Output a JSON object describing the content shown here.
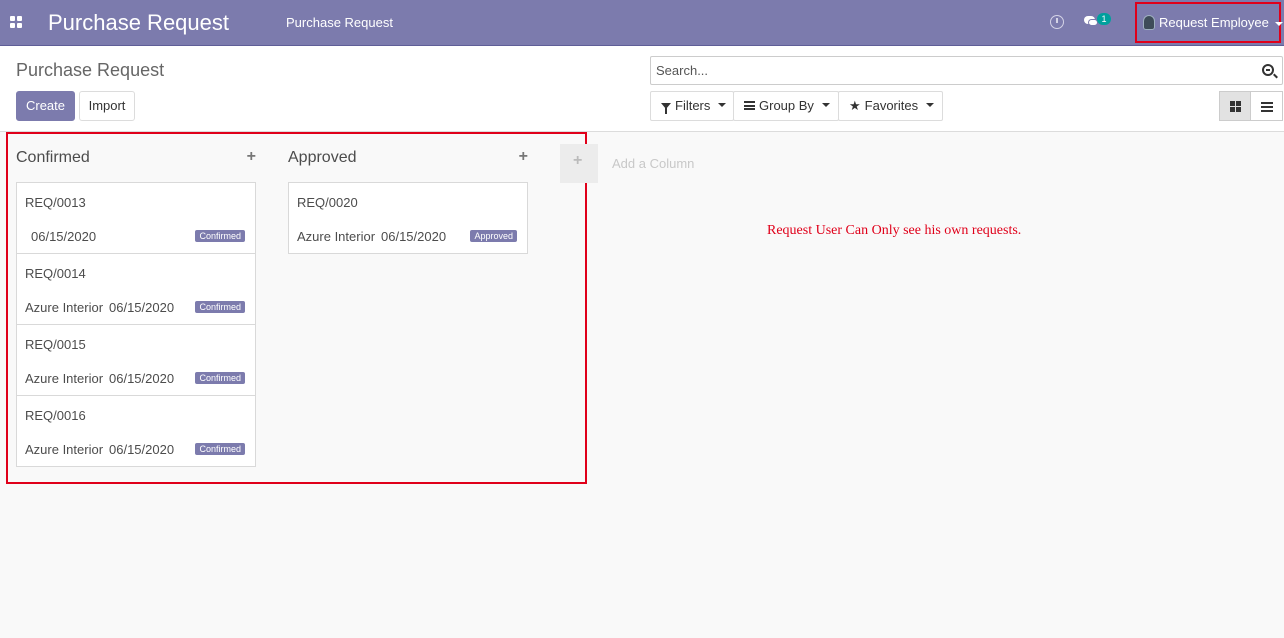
{
  "navbar": {
    "brand": "Purchase Request",
    "menu_item": "Purchase Request",
    "messages_count": "1",
    "user_name": "Request Employee",
    "icons": [
      "apps-icon",
      "clock-icon",
      "chat-icon",
      "avatar-icon"
    ]
  },
  "control_panel": {
    "title": "Purchase Request",
    "create_label": "Create",
    "import_label": "Import",
    "search_placeholder": "Search...",
    "filters_label": "Filters",
    "groupby_label": "Group By",
    "favorites_label": "Favorites"
  },
  "kanban": {
    "columns": [
      {
        "title": "Confirmed",
        "cards": [
          {
            "ref": "REQ/0013",
            "partner": "",
            "date": "06/15/2020",
            "state": "Confirmed"
          },
          {
            "ref": "REQ/0014",
            "partner": "Azure Interior",
            "date": "06/15/2020",
            "state": "Confirmed"
          },
          {
            "ref": "REQ/0015",
            "partner": "Azure Interior",
            "date": "06/15/2020",
            "state": "Confirmed"
          },
          {
            "ref": "REQ/0016",
            "partner": "Azure Interior",
            "date": "06/15/2020",
            "state": "Confirmed"
          }
        ]
      },
      {
        "title": "Approved",
        "cards": [
          {
            "ref": "REQ/0020",
            "partner": "Azure Interior",
            "date": "06/15/2020",
            "state": "Approved"
          }
        ]
      }
    ],
    "add_column_label": "Add a Column"
  },
  "annotation": {
    "note": "Request User Can Only see his own requests.",
    "highlight_color": "#e0001a"
  },
  "colors": {
    "brand": "#7c7bad",
    "badge": "#00a09d"
  }
}
